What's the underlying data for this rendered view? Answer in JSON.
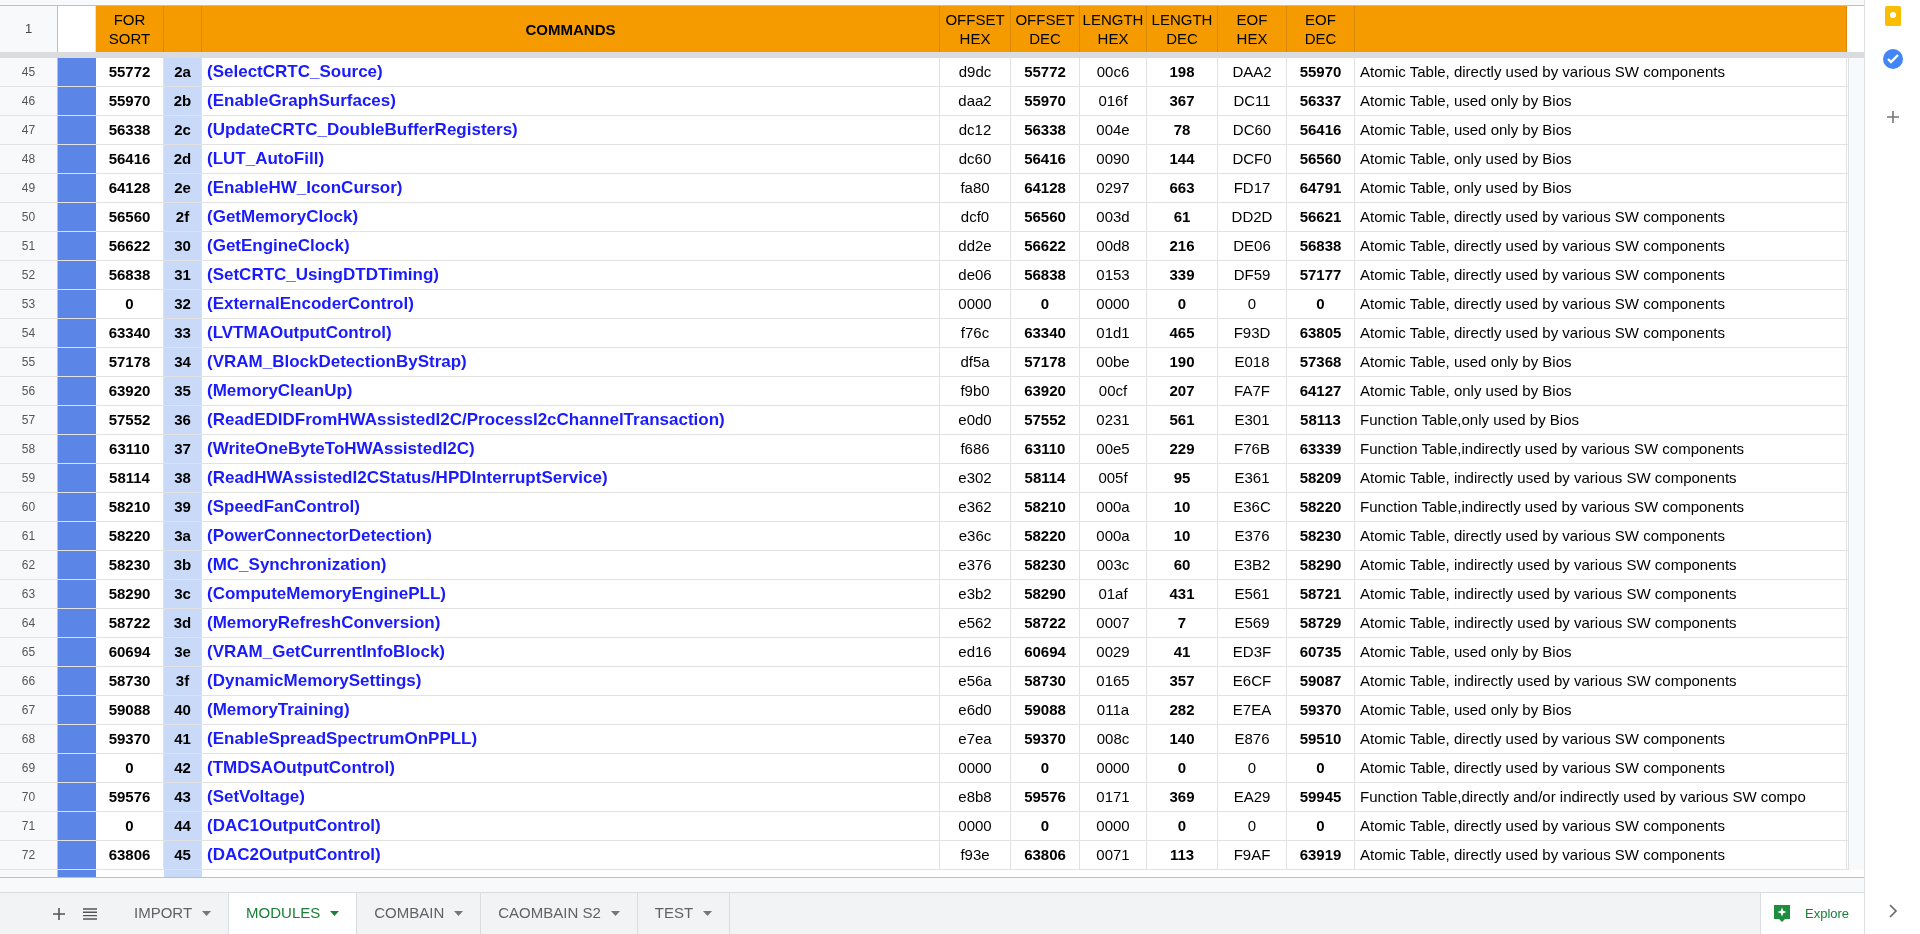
{
  "header": {
    "row_number": "1",
    "columns": [
      "FOR SORT",
      "",
      "COMMANDS",
      "OFFSET HEX",
      "OFFSET DEC",
      "LENGTH HEX",
      "LENGTH DEC",
      "EOF HEX",
      "EOF DEC",
      ""
    ]
  },
  "rows": [
    {
      "row_number": "45",
      "cells": [
        "55772",
        "2a",
        "(SelectCRTC_Source)",
        "d9dc",
        "55772",
        "00c6",
        "198",
        "DAA2",
        "55970",
        "Atomic Table,  directly used by various SW components"
      ]
    },
    {
      "row_number": "46",
      "cells": [
        "55970",
        "2b",
        "(EnableGraphSurfaces)",
        "daa2",
        "55970",
        "016f",
        "367",
        "DC11",
        "56337",
        "Atomic Table,  used only by Bios"
      ]
    },
    {
      "row_number": "47",
      "cells": [
        "56338",
        "2c",
        "(UpdateCRTC_DoubleBufferRegisters)",
        "dc12",
        "56338",
        "004e",
        "78",
        "DC60",
        "56416",
        "Atomic Table,  used only by Bios"
      ]
    },
    {
      "row_number": "48",
      "cells": [
        "56416",
        "2d",
        "(LUT_AutoFill)",
        "dc60",
        "56416",
        "0090",
        "144",
        "DCF0",
        "56560",
        "Atomic Table,  only used by Bios"
      ]
    },
    {
      "row_number": "49",
      "cells": [
        "64128",
        "2e",
        "(EnableHW_IconCursor)",
        "fa80",
        "64128",
        "0297",
        "663",
        "FD17",
        "64791",
        "Atomic Table,  only used by Bios"
      ]
    },
    {
      "row_number": "50",
      "cells": [
        "56560",
        "2f",
        "(GetMemoryClock)",
        "dcf0",
        "56560",
        "003d",
        "61",
        "DD2D",
        "56621",
        "Atomic Table,  directly used by various SW components"
      ]
    },
    {
      "row_number": "51",
      "cells": [
        "56622",
        "30",
        "(GetEngineClock)",
        "dd2e",
        "56622",
        "00d8",
        "216",
        "DE06",
        "56838",
        "Atomic Table,  directly used by various SW components"
      ]
    },
    {
      "row_number": "52",
      "cells": [
        "56838",
        "31",
        "(SetCRTC_UsingDTDTiming)",
        "de06",
        "56838",
        "0153",
        "339",
        "DF59",
        "57177",
        "Atomic Table,  directly used by various SW components"
      ]
    },
    {
      "row_number": "53",
      "cells": [
        "0",
        "32",
        "(ExternalEncoderControl)",
        "0000",
        "0",
        "0000",
        "0",
        "0",
        "0",
        "Atomic Table,  directly used by various SW components"
      ]
    },
    {
      "row_number": "54",
      "cells": [
        "63340",
        "33",
        "(LVTMAOutputControl)",
        "f76c",
        "63340",
        "01d1",
        "465",
        "F93D",
        "63805",
        "Atomic Table,  directly used by various SW components"
      ]
    },
    {
      "row_number": "55",
      "cells": [
        "57178",
        "34",
        "(VRAM_BlockDetectionByStrap)",
        "df5a",
        "57178",
        "00be",
        "190",
        "E018",
        "57368",
        "Atomic Table,  used only by Bios"
      ]
    },
    {
      "row_number": "56",
      "cells": [
        "63920",
        "35",
        "(MemoryCleanUp)",
        "f9b0",
        "63920",
        "00cf",
        "207",
        "FA7F",
        "64127",
        "Atomic Table,  only used by Bios"
      ]
    },
    {
      "row_number": "57",
      "cells": [
        "57552",
        "36",
        "(ReadEDIDFromHWAssistedI2C/ProcessI2cChannelTransaction)",
        "e0d0",
        "57552",
        "0231",
        "561",
        "E301",
        "58113",
        "Function Table,only used by Bios"
      ]
    },
    {
      "row_number": "58",
      "cells": [
        "63110",
        "37",
        "(WriteOneByteToHWAssistedI2C)",
        "f686",
        "63110",
        "00e5",
        "229",
        "F76B",
        "63339",
        "Function Table,indirectly used by various SW components"
      ]
    },
    {
      "row_number": "59",
      "cells": [
        "58114",
        "38",
        "(ReadHWAssistedI2CStatus/HPDInterruptService)",
        "e302",
        "58114",
        "005f",
        "95",
        "E361",
        "58209",
        "Atomic Table,  indirectly used by various SW components"
      ]
    },
    {
      "row_number": "60",
      "cells": [
        "58210",
        "39",
        "(SpeedFanControl)",
        "e362",
        "58210",
        "000a",
        "10",
        "E36C",
        "58220",
        "Function Table,indirectly used by various SW components"
      ]
    },
    {
      "row_number": "61",
      "cells": [
        "58220",
        "3a",
        "(PowerConnectorDetection)",
        "e36c",
        "58220",
        "000a",
        "10",
        "E376",
        "58230",
        "Atomic Table,  directly used by various SW components"
      ]
    },
    {
      "row_number": "62",
      "cells": [
        "58230",
        "3b",
        "(MC_Synchronization)",
        "e376",
        "58230",
        "003c",
        "60",
        "E3B2",
        "58290",
        "Atomic Table,  indirectly used by various SW components"
      ]
    },
    {
      "row_number": "63",
      "cells": [
        "58290",
        "3c",
        "(ComputeMemoryEnginePLL)",
        "e3b2",
        "58290",
        "01af",
        "431",
        "E561",
        "58721",
        "Atomic Table,  indirectly used by various SW components"
      ]
    },
    {
      "row_number": "64",
      "cells": [
        "58722",
        "3d",
        "(MemoryRefreshConversion)",
        "e562",
        "58722",
        "0007",
        "7",
        "E569",
        "58729",
        "Atomic Table,  indirectly used by various SW components"
      ]
    },
    {
      "row_number": "65",
      "cells": [
        "60694",
        "3e",
        "(VRAM_GetCurrentInfoBlock)",
        "ed16",
        "60694",
        "0029",
        "41",
        "ED3F",
        "60735",
        "Atomic Table,  used only by Bios"
      ]
    },
    {
      "row_number": "66",
      "cells": [
        "58730",
        "3f",
        "(DynamicMemorySettings)",
        "e56a",
        "58730",
        "0165",
        "357",
        "E6CF",
        "59087",
        "Atomic Table,  indirectly used by various SW components"
      ]
    },
    {
      "row_number": "67",
      "cells": [
        "59088",
        "40",
        "(MemoryTraining)",
        "e6d0",
        "59088",
        "011a",
        "282",
        "E7EA",
        "59370",
        "Atomic Table,  used only by Bios"
      ]
    },
    {
      "row_number": "68",
      "cells": [
        "59370",
        "41",
        "(EnableSpreadSpectrumOnPPLL)",
        "e7ea",
        "59370",
        "008c",
        "140",
        "E876",
        "59510",
        "Atomic Table,  directly used by various SW components"
      ]
    },
    {
      "row_number": "69",
      "cells": [
        "0",
        "42",
        "(TMDSAOutputControl)",
        "0000",
        "0",
        "0000",
        "0",
        "0",
        "0",
        "Atomic Table,  directly used by various SW components"
      ]
    },
    {
      "row_number": "70",
      "cells": [
        "59576",
        "43",
        "(SetVoltage)",
        "e8b8",
        "59576",
        "0171",
        "369",
        "EA29",
        "59945",
        "Function Table,directly and/or indirectly used by various SW compo"
      ]
    },
    {
      "row_number": "71",
      "cells": [
        "0",
        "44",
        "(DAC1OutputControl)",
        "0000",
        "0",
        "0000",
        "0",
        "0",
        "0",
        "Atomic Table,  directly used by various SW components"
      ]
    },
    {
      "row_number": "72",
      "cells": [
        "63806",
        "45",
        "(DAC2OutputControl)",
        "f93e",
        "63806",
        "0071",
        "113",
        "F9AF",
        "63919",
        "Atomic Table,  directly used by various SW components"
      ]
    }
  ],
  "sheet_tabs": [
    {
      "label": "IMPORT",
      "selected": false
    },
    {
      "label": "MODULES",
      "selected": true
    },
    {
      "label": "COMBAIN",
      "selected": false
    },
    {
      "label": "CAOMBAIN S2",
      "selected": false
    },
    {
      "label": "TEST",
      "selected": false
    }
  ],
  "explore_button": {
    "label": "Explore"
  }
}
